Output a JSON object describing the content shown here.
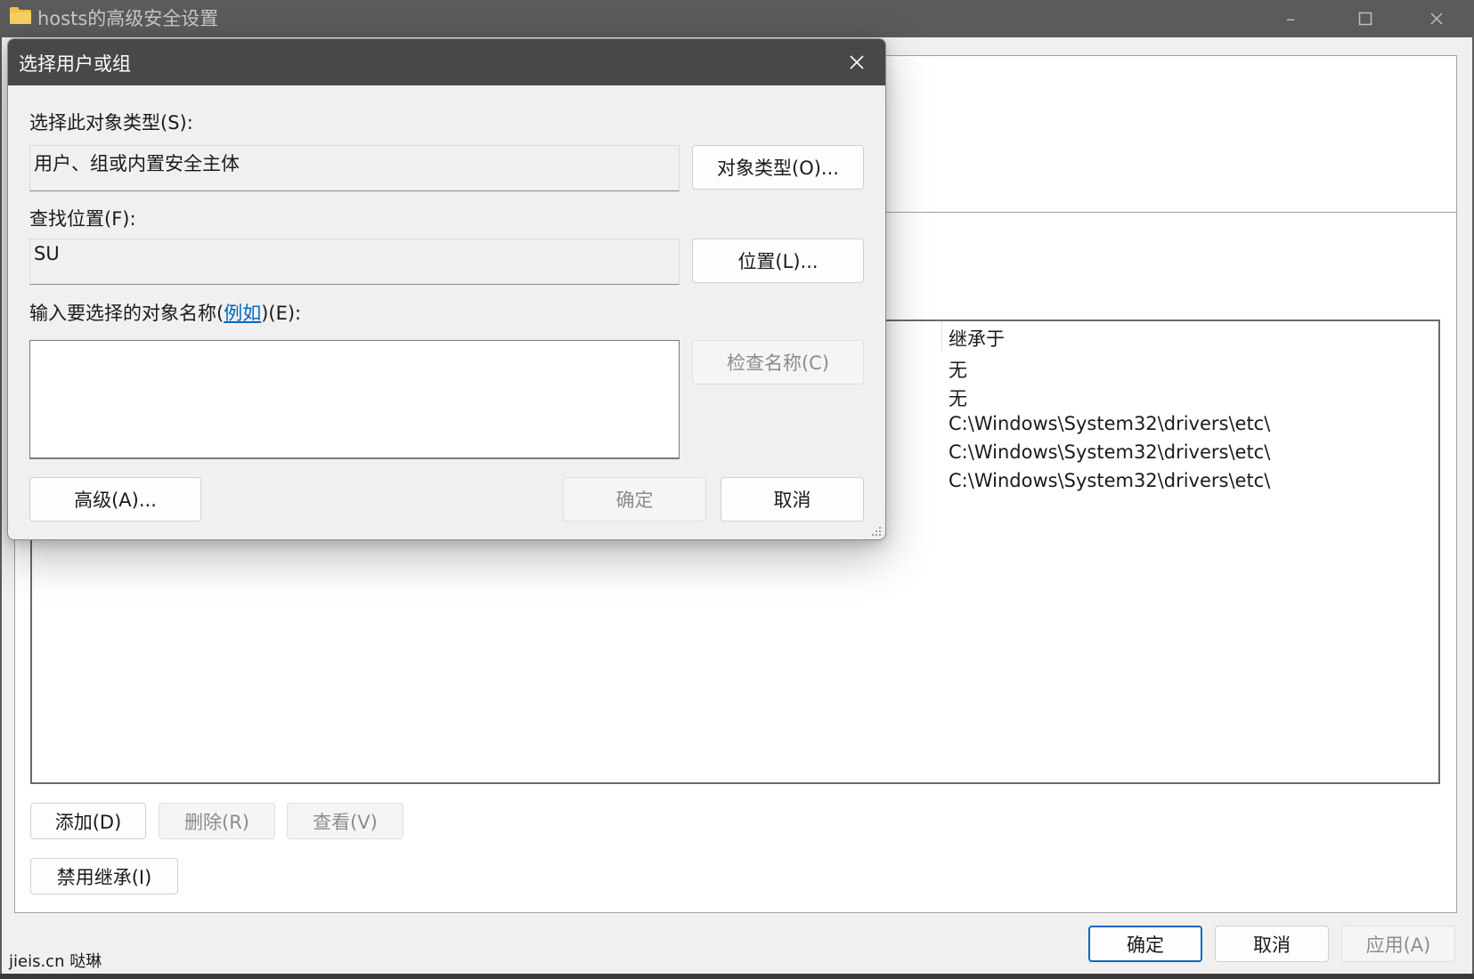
{
  "background_window": {
    "title": "hosts的高级安全设置",
    "inheritance_column_header": "继承于",
    "inheritance_rows": [
      "无",
      "无",
      "C:\\Windows\\System32\\drivers\\etc\\",
      "C:\\Windows\\System32\\drivers\\etc\\",
      "C:\\Windows\\System32\\drivers\\etc\\"
    ],
    "buttons": {
      "add": "添加(D)",
      "remove": "删除(R)",
      "view": "查看(V)",
      "disable_inheritance": "禁用继承(I)",
      "ok": "确定",
      "cancel": "取消",
      "apply": "应用(A)"
    }
  },
  "dialog": {
    "title": "选择用户或组",
    "object_type_label": "选择此对象类型(S):",
    "object_type_value": "用户、组或内置安全主体",
    "object_types_button": "对象类型(O)...",
    "location_label": "查找位置(F):",
    "location_value": "SU",
    "locations_button": "位置(L)...",
    "names_label_prefix": "输入要选择的对象名称(",
    "names_label_link": "例如",
    "names_label_suffix": ")(E):",
    "names_value": "",
    "check_names_button": "检查名称(C)",
    "advanced_button": "高级(A)...",
    "ok_button": "确定",
    "cancel_button": "取消"
  },
  "watermark": "jieis.cn 哒琳",
  "colors": {
    "titlebar": "#5b5b5b",
    "dialog_titlebar": "#484848",
    "link": "#0067c0",
    "primary_border": "#0067c0"
  }
}
